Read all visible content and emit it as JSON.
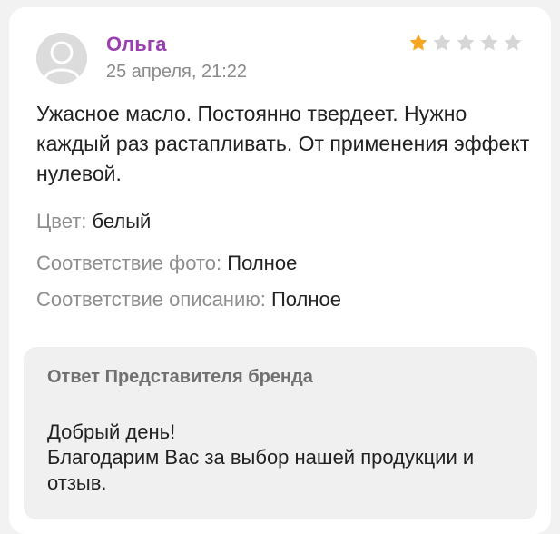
{
  "review": {
    "author": "Ольга",
    "date": "25 апреля, 21:22",
    "rating": 1,
    "rating_max": 5,
    "text": "Ужасное масло. Постоянно твердеет. Нужно каждый раз растапливать. От применения эффект нулевой.",
    "attributes": [
      {
        "label": "Цвет:",
        "value": "белый"
      },
      {
        "label": "Соответствие фото:",
        "value": "Полное"
      },
      {
        "label": "Соответствие описанию:",
        "value": "Полное"
      }
    ]
  },
  "brand_reply": {
    "title": "Ответ Представителя бренда",
    "lines": [
      "Добрый день!",
      "Благодарим Вас за выбор нашей продукции и отзыв."
    ]
  },
  "colors": {
    "author": "#9a3fb0",
    "star_filled": "#f5a623",
    "star_empty": "#d6d6d6",
    "reply_background": "#f0f0f0"
  },
  "icons": {
    "avatar": "user-avatar-icon",
    "star": "star-icon"
  }
}
